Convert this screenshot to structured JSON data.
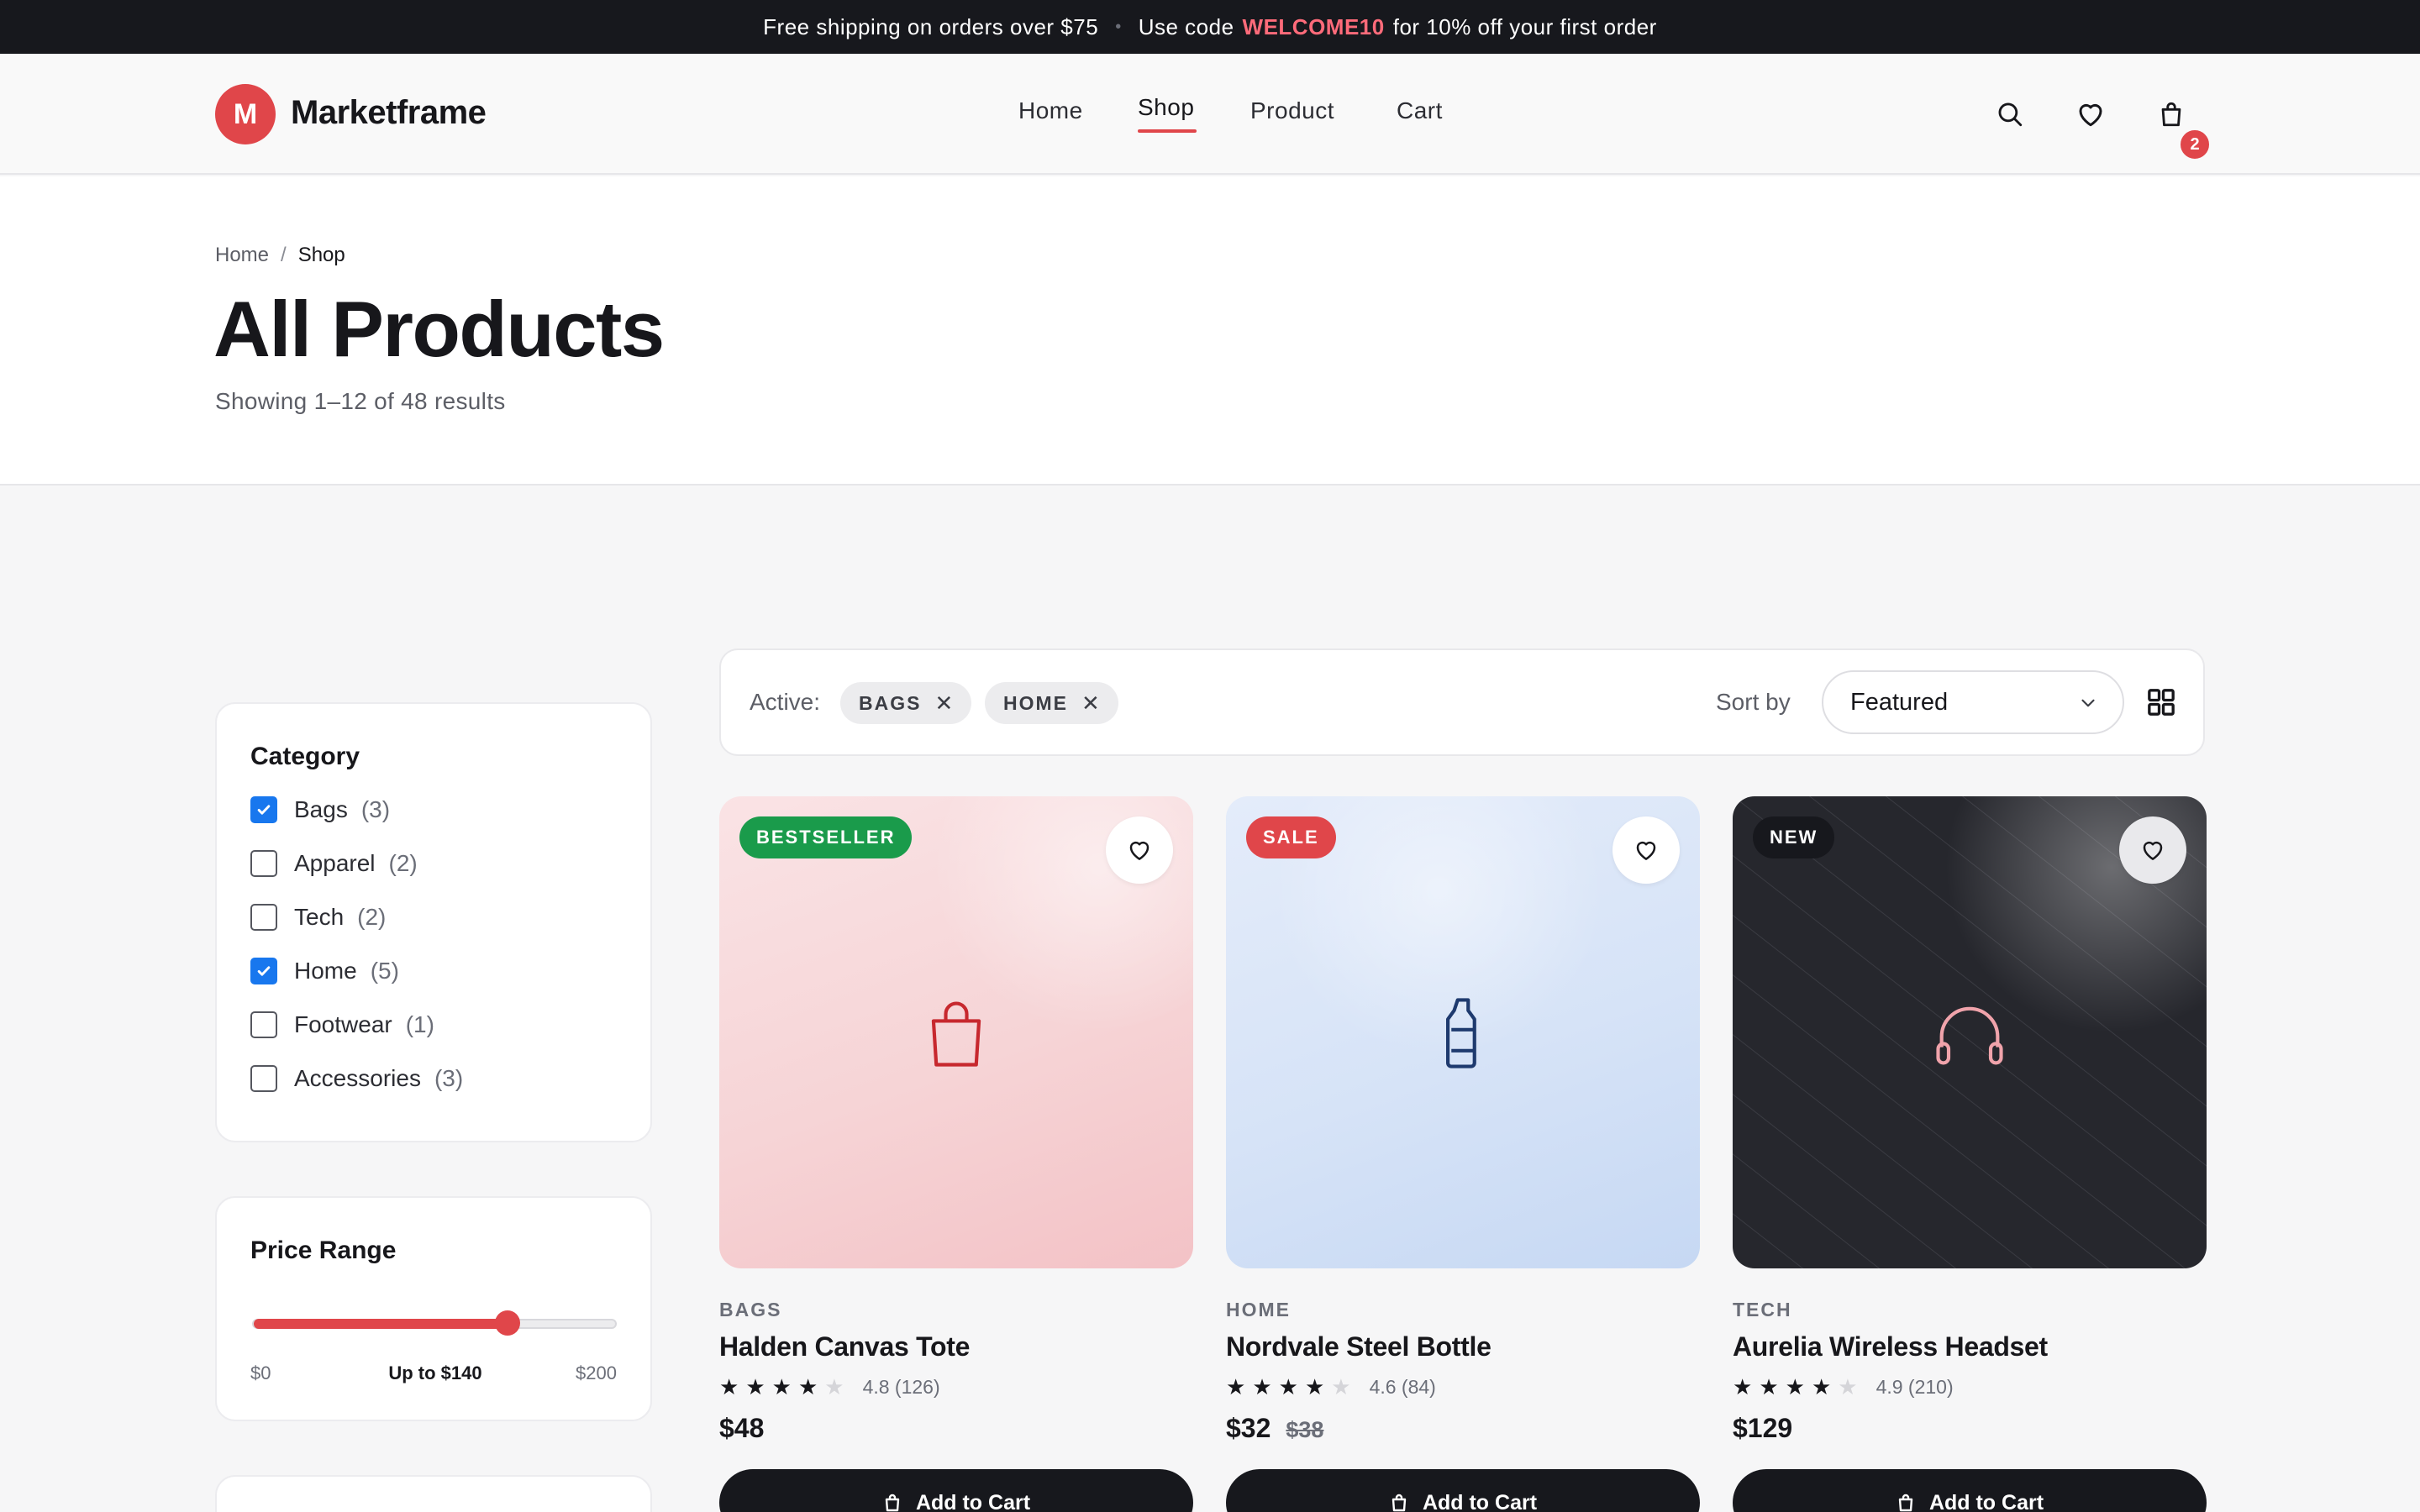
{
  "promo": {
    "text": "Free shipping on orders over $75",
    "separator": "•",
    "code_prefix": "Use code",
    "code": "WELCOME10",
    "code_suffix": "for 10% off your first order"
  },
  "brand": {
    "initial": "M",
    "name": "Marketframe",
    "accent": "#e0464a"
  },
  "nav": [
    {
      "label": "Home",
      "active": false
    },
    {
      "label": "Shop",
      "active": true
    },
    {
      "label": "Product",
      "active": false
    },
    {
      "label": "Cart",
      "active": false
    }
  ],
  "header_icons": [
    "search-icon",
    "heart-icon",
    "shopping-bag-icon"
  ],
  "cart_count": "2",
  "breadcrumb": {
    "home": "Home",
    "separator": "/",
    "current": "Shop"
  },
  "page": {
    "title": "All Products",
    "results": "Showing 1–12 of 48 results"
  },
  "filters": {
    "category_title": "Category",
    "categories": [
      {
        "label": "Bags",
        "count": "(3)",
        "checked": true
      },
      {
        "label": "Apparel",
        "count": "(2)",
        "checked": false
      },
      {
        "label": "Tech",
        "count": "(2)",
        "checked": false
      },
      {
        "label": "Home",
        "count": "(5)",
        "checked": true
      },
      {
        "label": "Footwear",
        "count": "(1)",
        "checked": false
      },
      {
        "label": "Accessories",
        "count": "(3)",
        "checked": false
      }
    ],
    "price_title": "Price Range",
    "price_min": "$0",
    "price_value": "Up to $140",
    "price_max": "$200",
    "price_fraction": 0.7
  },
  "toolbar": {
    "active_label": "Active:",
    "chips": [
      "BAGS",
      "HOME"
    ],
    "sort_label": "Sort by",
    "sort_value": "Featured"
  },
  "products": [
    {
      "badge": "BESTSELLER",
      "badge_color": "#1a9b4b",
      "category": "BAGS",
      "name": "Halden Canvas Tote",
      "rating": 4,
      "rating_text": "4.8 (126)",
      "price": "$48",
      "old_price": "",
      "button": "Add to Cart",
      "icon": "shopping-bag-icon",
      "icon_color": "#c7282e"
    },
    {
      "badge": "SALE",
      "badge_color": "#e0464a",
      "category": "HOME",
      "name": "Nordvale Steel Bottle",
      "rating": 4,
      "rating_text": "4.6 (84)",
      "price": "$32",
      "old_price": "$38",
      "button": "Add to Cart",
      "icon": "bottle-icon",
      "icon_color": "#1e3a6e"
    },
    {
      "badge": "NEW",
      "badge_color": "#17181d",
      "category": "TECH",
      "name": "Aurelia Wireless Headset",
      "rating": 4,
      "rating_text": "4.9 (210)",
      "price": "$129",
      "old_price": "",
      "button": "Add to Cart",
      "icon": "headphones-icon",
      "icon_color": "#f0a3ab"
    }
  ]
}
